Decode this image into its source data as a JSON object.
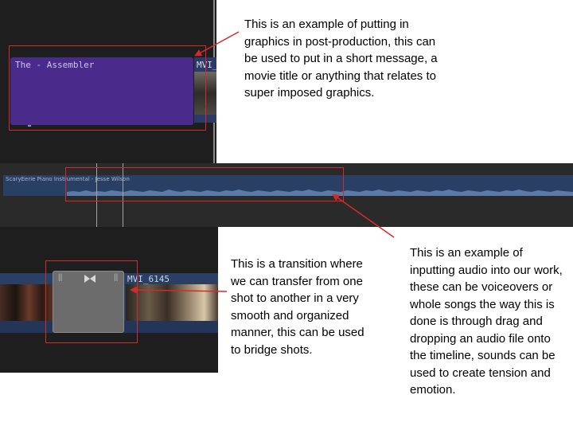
{
  "title_clip": {
    "label": "The  - Assembler"
  },
  "top_video_clip": {
    "label": "MVI_"
  },
  "audio_clip": {
    "label": "ScaryEerie Piano Instrumental - Jesse Wilson"
  },
  "transition_clip": {
    "label": "MVI_6145",
    "handle_left": "||",
    "handle_right": "||"
  },
  "annotations": {
    "graphics": "This is an example of putting in graphics in post-production, this can be used to put in a short message, a movie title or anything that relates to super imposed graphics.",
    "transition": "This is a transition where we can transfer from one shot to another in a very smooth and organized manner, this can be used to bridge shots.",
    "audio": "This is an example of inputting audio into our work, these can be voiceovers or whole songs the way this is done is through drag and dropping an audio file onto the timeline, sounds can be used to create tension and emotion."
  },
  "colors": {
    "highlight": "#d62a2a",
    "title_clip": "#4a2a8a",
    "timeline_clip": "#2a3f64",
    "transition": "#6c6c6c"
  },
  "icons": {
    "transition": "bowtie-transition-icon"
  }
}
